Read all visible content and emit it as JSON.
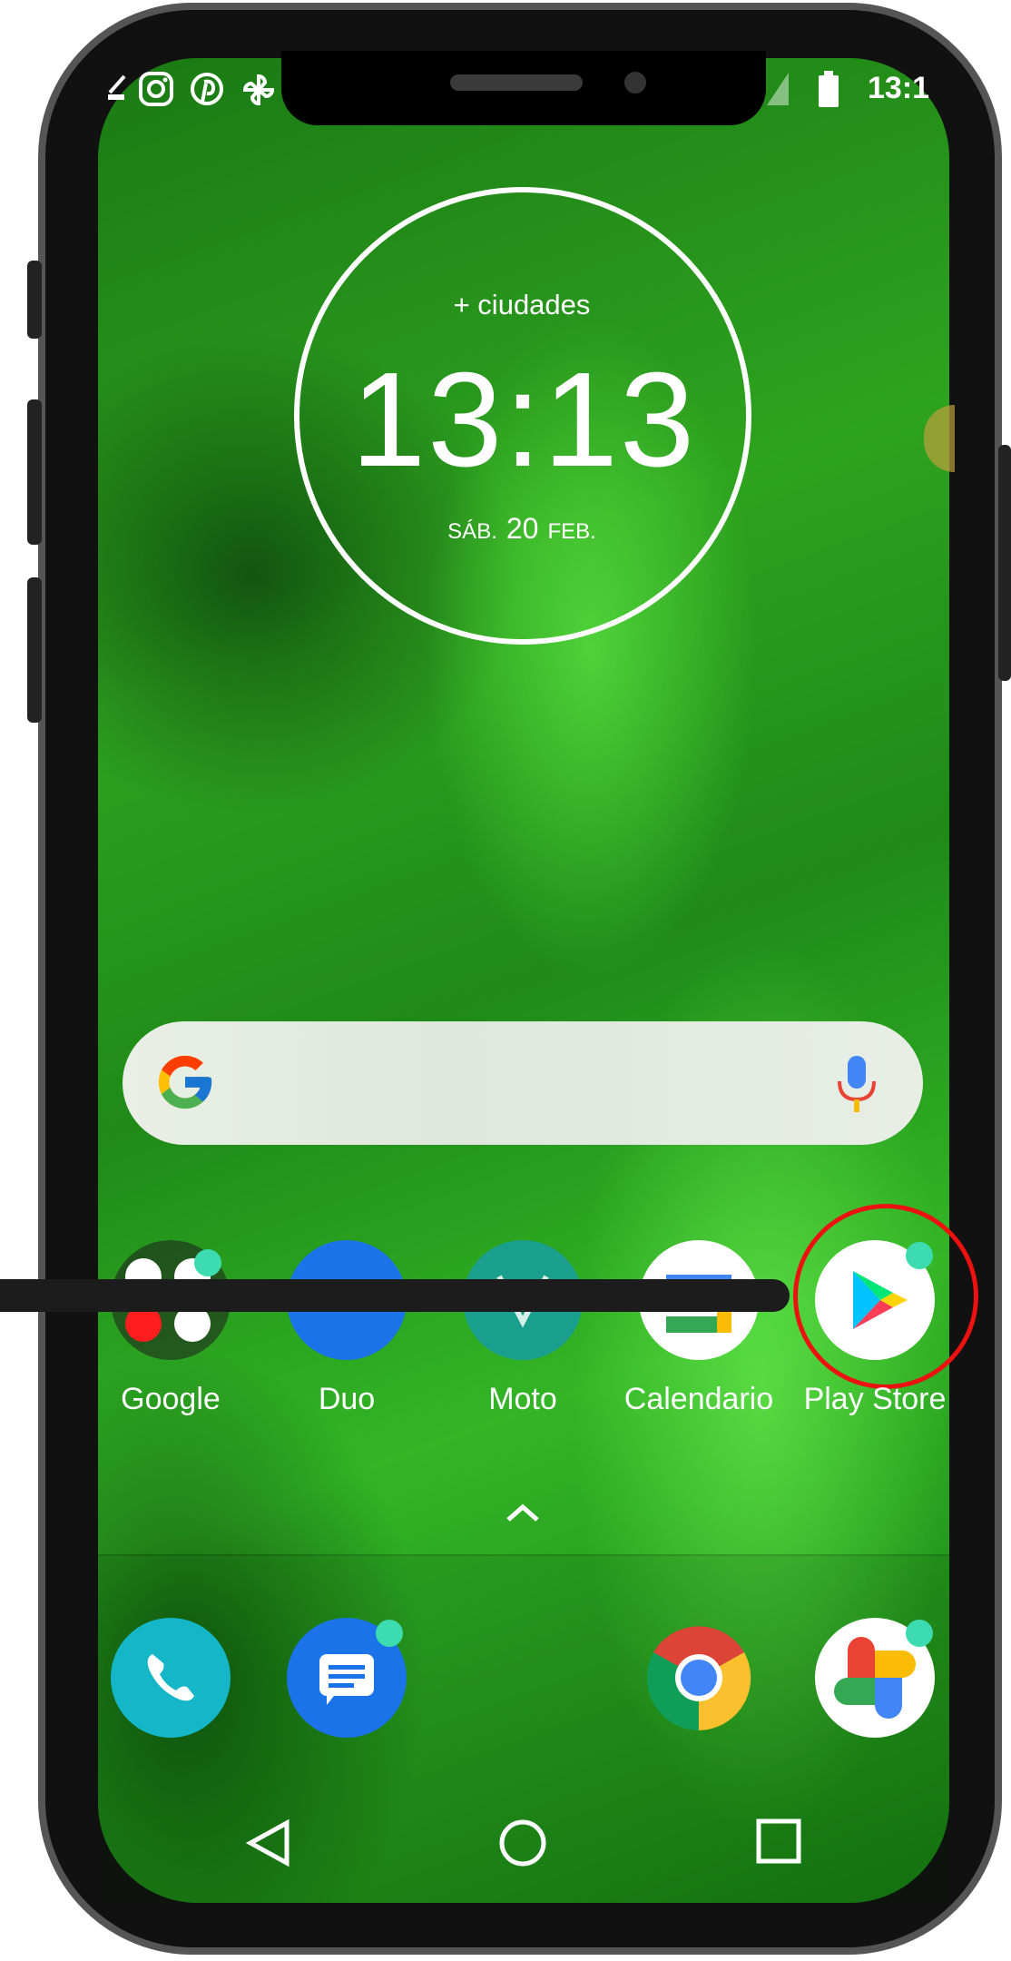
{
  "status_bar": {
    "time": "13:1",
    "icons": [
      "instagram-icon",
      "pinterest-icon",
      "pinwheel-icon",
      "signal-icon",
      "battery-icon"
    ]
  },
  "clock_widget": {
    "cities": "+ ciudades",
    "time": "13:13",
    "day": "SÁB.",
    "date": "20",
    "month": "FEB."
  },
  "search_bar": {
    "icons": [
      "google-g-icon",
      "microphone-icon"
    ]
  },
  "apps": [
    {
      "label": "Google",
      "icon": "google-folder-icon"
    },
    {
      "label": "Duo",
      "icon": "duo-icon"
    },
    {
      "label": "Moto",
      "icon": "moto-icon"
    },
    {
      "label": "Calendario",
      "icon": "calendar-icon"
    },
    {
      "label": "Play Store",
      "icon": "play-store-icon"
    }
  ],
  "dock": [
    {
      "icon": "phone-icon"
    },
    {
      "icon": "messages-icon"
    },
    {
      "icon": "chrome-icon"
    },
    {
      "icon": "photos-icon"
    }
  ],
  "nav_bar": {
    "icons": [
      "back-icon",
      "home-icon",
      "recents-icon"
    ]
  },
  "colors": {
    "highlight": "#e11111",
    "notification_dot": "#3ddcb0"
  }
}
